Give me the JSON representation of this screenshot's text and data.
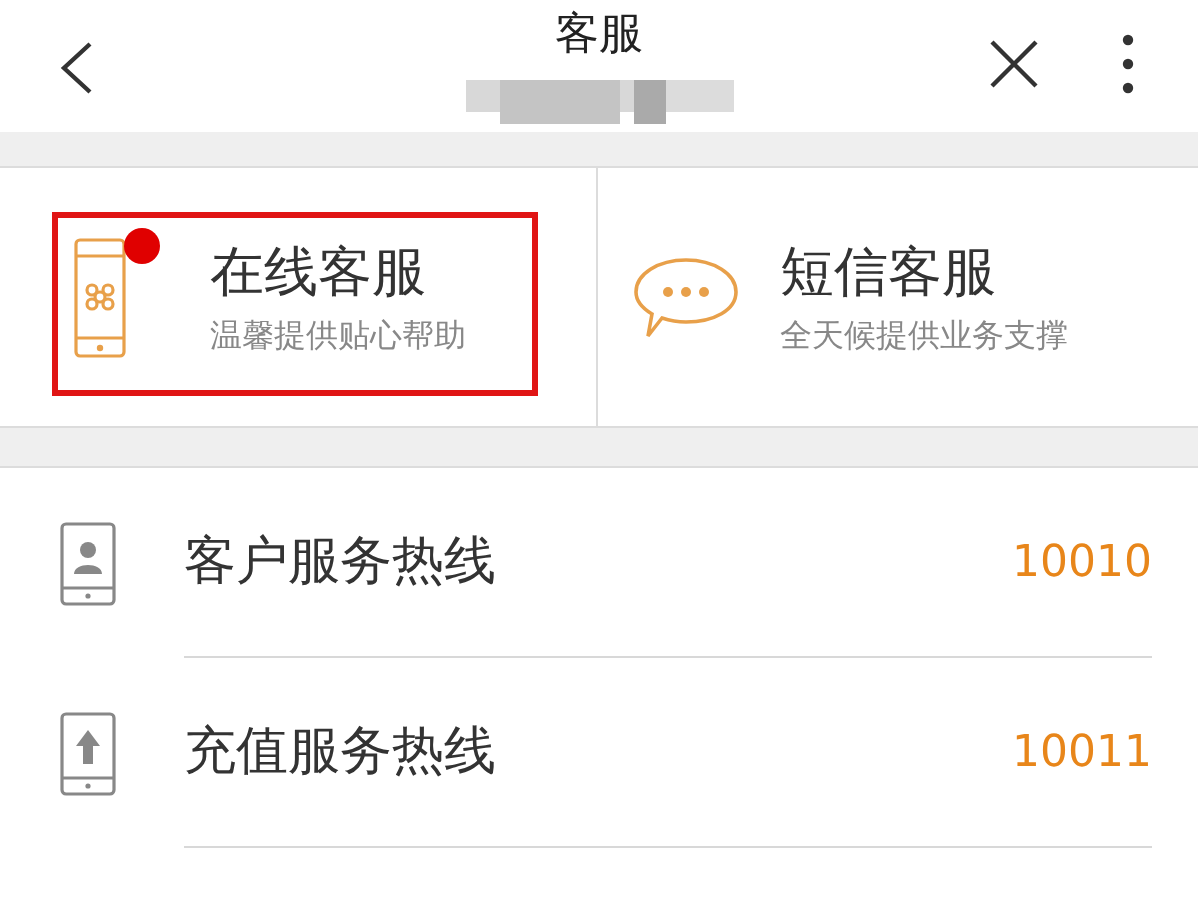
{
  "header": {
    "title": "客服"
  },
  "services": [
    {
      "kind": "online",
      "title": "在线客服",
      "subtitle": "温馨提供贴心帮助",
      "badge": true,
      "highlighted": true
    },
    {
      "kind": "sms",
      "title": "短信客服",
      "subtitle": "全天候提供业务支撑",
      "badge": false,
      "highlighted": false
    }
  ],
  "hotlines": [
    {
      "kind": "service",
      "label": "客户服务热线",
      "number": "10010"
    },
    {
      "kind": "recharge",
      "label": "充值服务热线",
      "number": "10011"
    }
  ]
}
